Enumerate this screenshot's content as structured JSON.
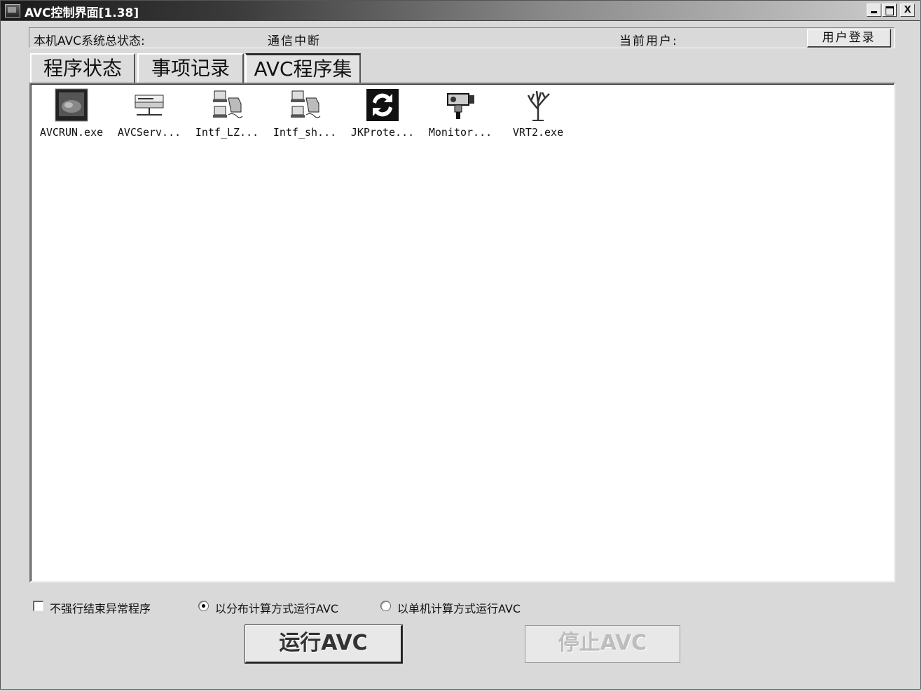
{
  "window": {
    "title": "AVC控制界面[1.38]",
    "minimize": "_",
    "maximize": "□",
    "close": "X"
  },
  "status": {
    "system_label": "本机AVC系统总状态:",
    "system_value": "通信中断",
    "user_label": "当前用户:",
    "login_button": "用户登录"
  },
  "tabs": [
    {
      "label": "程序状态",
      "active": false
    },
    {
      "label": "事项记录",
      "active": false
    },
    {
      "label": "AVC程序集",
      "active": true
    }
  ],
  "programs": [
    {
      "label": "AVCRUN.exe",
      "icon": "monitor-screen-icon"
    },
    {
      "label": "AVCServ...",
      "icon": "server-icon"
    },
    {
      "label": "Intf_LZ...",
      "icon": "network-computers-icon"
    },
    {
      "label": "Intf_sh...",
      "icon": "network-computers-icon"
    },
    {
      "label": "JKProte...",
      "icon": "refresh-arrows-icon"
    },
    {
      "label": "Monitor...",
      "icon": "camera-icon"
    },
    {
      "label": "VRT2.exe",
      "icon": "tree-icon"
    }
  ],
  "options": {
    "no_force_kill_label": "不强行结束异常程序",
    "no_force_kill_checked": false,
    "distributed_label": "以分布计算方式运行AVC",
    "distributed_selected": true,
    "single_label": "以单机计算方式运行AVC",
    "single_selected": false
  },
  "actions": {
    "run_label": "运行AVC",
    "stop_label": "停止AVC",
    "stop_enabled": false
  },
  "colors": {
    "titlebar_start": "#1a1a1a",
    "titlebar_end": "#cfcfcf",
    "background": "#d9d9d9",
    "panel": "#ffffff"
  }
}
